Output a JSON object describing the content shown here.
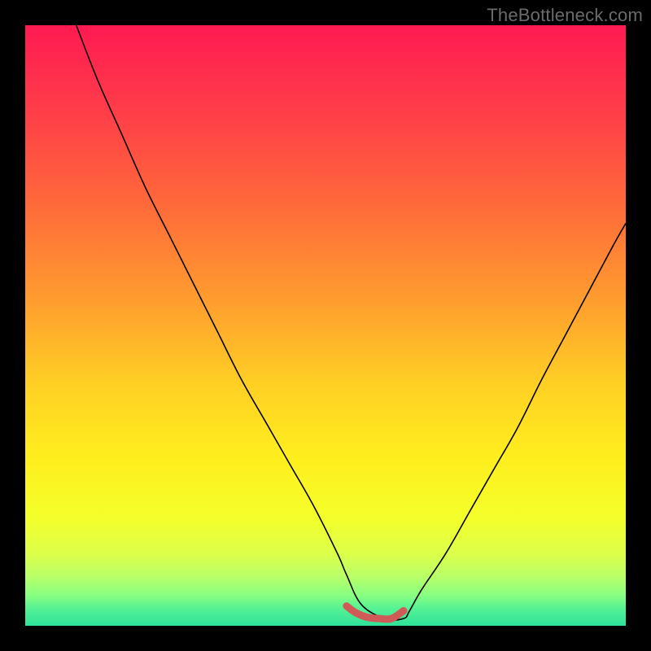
{
  "watermark": "TheBottleneck.com",
  "chart_data": {
    "type": "line",
    "title": "",
    "xlabel": "",
    "ylabel": "",
    "xlim": [
      0,
      100
    ],
    "ylim": [
      0,
      100
    ],
    "legend": false,
    "grid": false,
    "background_gradient": {
      "stops": [
        {
          "pos": 0.0,
          "color": "#ff1a52"
        },
        {
          "pos": 0.15,
          "color": "#ff3f48"
        },
        {
          "pos": 0.3,
          "color": "#ff6a3a"
        },
        {
          "pos": 0.45,
          "color": "#ff9a2f"
        },
        {
          "pos": 0.6,
          "color": "#ffd024"
        },
        {
          "pos": 0.72,
          "color": "#ffee1e"
        },
        {
          "pos": 0.82,
          "color": "#f4ff2a"
        },
        {
          "pos": 0.88,
          "color": "#dcff4a"
        },
        {
          "pos": 0.92,
          "color": "#b6ff6a"
        },
        {
          "pos": 0.95,
          "color": "#86ff82"
        },
        {
          "pos": 0.97,
          "color": "#58f294"
        },
        {
          "pos": 1.0,
          "color": "#2de29a"
        }
      ]
    },
    "series": [
      {
        "name": "bottleneck-curve",
        "x": [
          8.5,
          12,
          16,
          20,
          24,
          28,
          32,
          36,
          40,
          44,
          48,
          52,
          53.5,
          56,
          60,
          63,
          64,
          66,
          70,
          74,
          78,
          82,
          86,
          90,
          94,
          98,
          100
        ],
        "values": [
          100,
          91,
          82,
          73,
          65,
          57,
          49,
          41,
          34,
          27,
          20,
          12,
          8.5,
          3.5,
          1.2,
          1.2,
          2.5,
          6,
          12,
          19,
          26,
          33,
          41,
          48.5,
          56,
          63.5,
          67
        ]
      }
    ],
    "highlight_segment": {
      "name": "optimal-range-marker",
      "color": "#cf5a57",
      "points_x": [
        53.5,
        55.0,
        57.0,
        59.0,
        61.0,
        63.0
      ],
      "points_y": [
        3.3,
        2.2,
        1.4,
        1.2,
        1.2,
        2.5
      ]
    }
  }
}
